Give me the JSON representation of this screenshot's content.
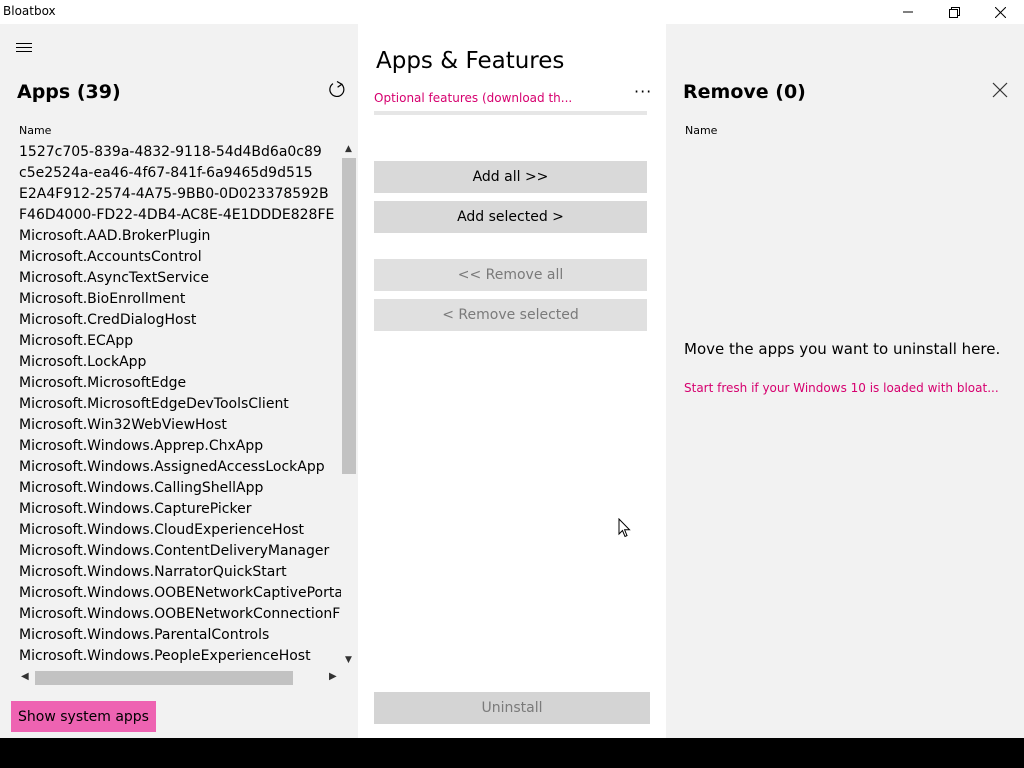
{
  "window": {
    "title": "Bloatbox"
  },
  "left": {
    "title": "Apps (39)",
    "column_name": "Name",
    "apps": [
      "1527c705-839a-4832-9118-54d4Bd6a0c89",
      "c5e2524a-ea46-4f67-841f-6a9465d9d515",
      "E2A4F912-2574-4A75-9BB0-0D023378592B",
      "F46D4000-FD22-4DB4-AC8E-4E1DDDE828FE",
      "Microsoft.AAD.BrokerPlugin",
      "Microsoft.AccountsControl",
      "Microsoft.AsyncTextService",
      "Microsoft.BioEnrollment",
      "Microsoft.CredDialogHost",
      "Microsoft.ECApp",
      "Microsoft.LockApp",
      "Microsoft.MicrosoftEdge",
      "Microsoft.MicrosoftEdgeDevToolsClient",
      "Microsoft.Win32WebViewHost",
      "Microsoft.Windows.Apprep.ChxApp",
      "Microsoft.Windows.AssignedAccessLockApp",
      "Microsoft.Windows.CallingShellApp",
      "Microsoft.Windows.CapturePicker",
      "Microsoft.Windows.CloudExperienceHost",
      "Microsoft.Windows.ContentDeliveryManager",
      "Microsoft.Windows.NarratorQuickStart",
      "Microsoft.Windows.OOBENetworkCaptivePorta",
      "Microsoft.Windows.OOBENetworkConnectionF",
      "Microsoft.Windows.ParentalControls",
      "Microsoft.Windows.PeopleExperienceHost"
    ],
    "show_system_label": "Show system apps"
  },
  "middle": {
    "title": "Apps & Features",
    "optional_link": "Optional features (download th...",
    "more_label": "···",
    "add_all": "Add all >>",
    "add_selected": "Add selected >",
    "remove_all": "<< Remove all",
    "remove_selected": "< Remove selected",
    "uninstall": "Uninstall"
  },
  "right": {
    "title": "Remove (0)",
    "column_name": "Name",
    "empty_text": "Move the apps you want to uninstall here.",
    "fresh_link": "Start fresh if your Windows 10 is loaded with bloat..."
  },
  "colors": {
    "accent_pink": "#ee63b2",
    "link_magenta": "#d6006f"
  }
}
